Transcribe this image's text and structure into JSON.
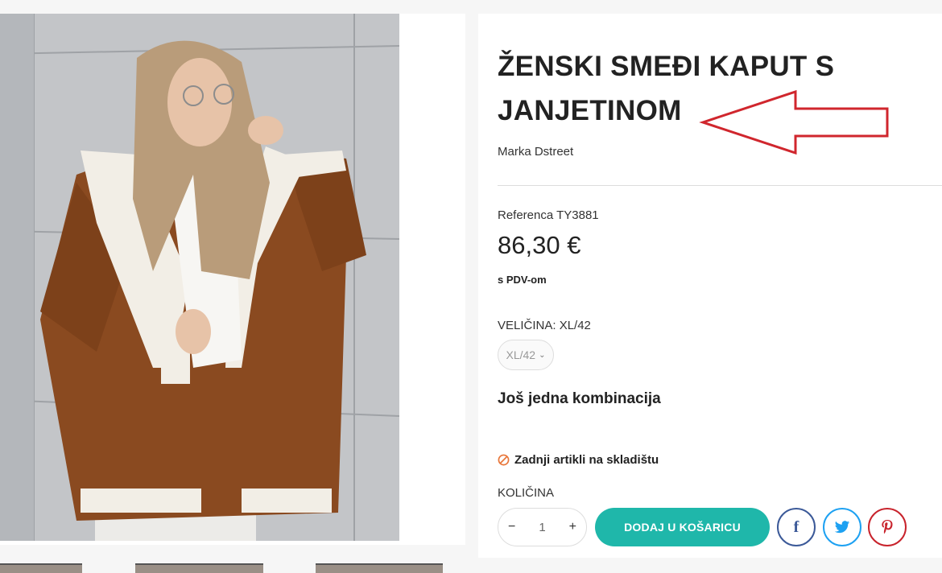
{
  "product": {
    "title": "ŽENSKI SMEĐI KAPUT S JANJETINOM",
    "brand": "Marka Dstreet",
    "reference": "Referenca TY3881",
    "price": "86,30 €",
    "tax_note": "s PDV-om",
    "size_label": "VELIČINA: XL/42",
    "size_selected": "XL/42",
    "combination_heading": "Još jedna kombinacija",
    "stock_status": "Zadnji artikli na skladištu",
    "quantity_label": "KOLIČINA",
    "quantity_value": "1",
    "qty_minus": "−",
    "qty_plus": "+",
    "add_to_cart": "DODAJ U KOŠARICU"
  },
  "social": {
    "facebook_glyph": "f",
    "colors": {
      "facebook": "#3b5998",
      "twitter": "#1da1f2",
      "pinterest": "#c8232c"
    }
  },
  "colors": {
    "accent": "#1fb7aa",
    "annotation_arrow": "#d0262d",
    "stock_warning": "#e8763a"
  },
  "icons": [
    "chevron-down-icon",
    "no-entry-icon",
    "facebook-icon",
    "twitter-icon",
    "pinterest-icon",
    "annotation-arrow"
  ]
}
